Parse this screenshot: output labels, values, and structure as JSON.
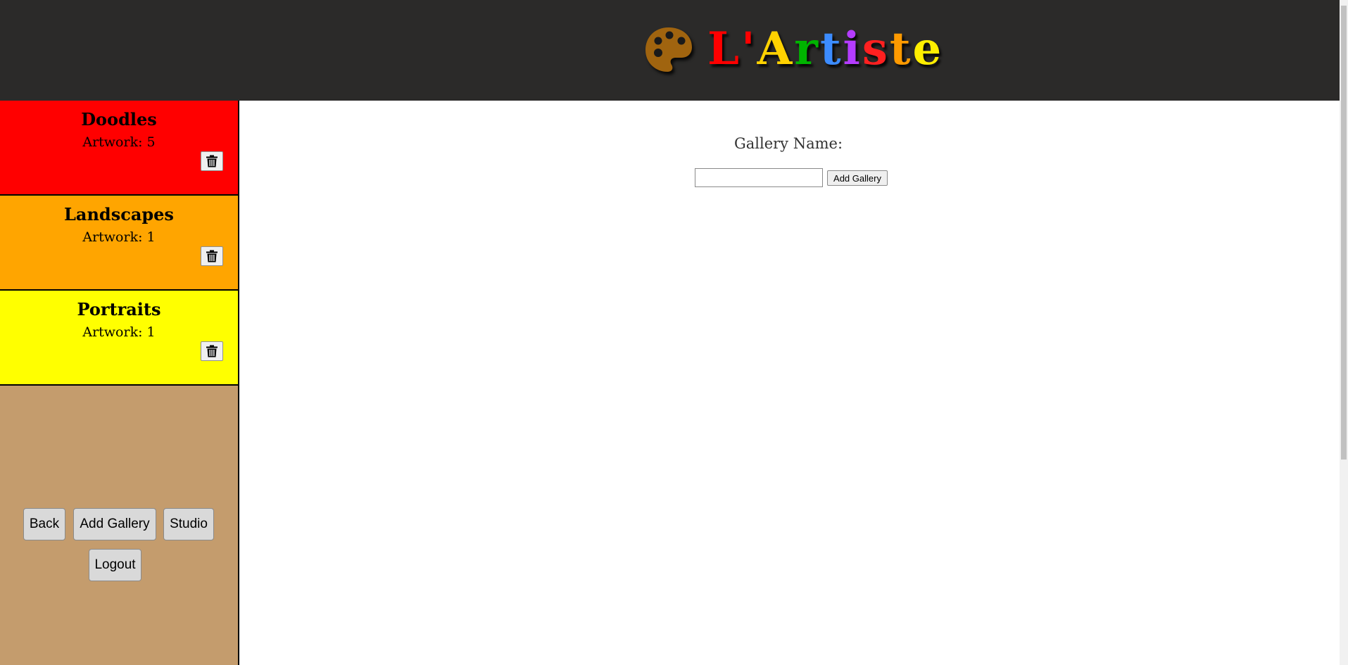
{
  "header": {
    "icon": "palette-icon",
    "title_letters": [
      {
        "ch": "L",
        "color": "#ff0000"
      },
      {
        "ch": "'",
        "color": "#ff0000"
      },
      {
        "ch": "A",
        "color": "#ffd200"
      },
      {
        "ch": "r",
        "color": "#00b400"
      },
      {
        "ch": "t",
        "color": "#3c8cff"
      },
      {
        "ch": "i",
        "color": "#b43cff"
      },
      {
        "ch": "s",
        "color": "#ff2020"
      },
      {
        "ch": "t",
        "color": "#ff9a00"
      },
      {
        "ch": "e",
        "color": "#ffee00"
      }
    ],
    "background": "#2b2a29"
  },
  "sidebar": {
    "background": "#c49c6d",
    "galleries": [
      {
        "name": "Doodles",
        "count": "Artwork: 5",
        "color": "#ff0000",
        "icon": "trash-icon"
      },
      {
        "name": "Landscapes",
        "count": "Artwork: 1",
        "color": "#ffa500",
        "icon": "trash-icon"
      },
      {
        "name": "Portraits",
        "count": "Artwork: 1",
        "color": "#ffff00",
        "icon": "trash-icon"
      }
    ],
    "buttons": {
      "back": "Back",
      "add_gallery": "Add Gallery",
      "studio": "Studio",
      "logout": "Logout"
    }
  },
  "main": {
    "label": "Gallery Name:",
    "input_value": "",
    "add_button": "Add Gallery"
  }
}
